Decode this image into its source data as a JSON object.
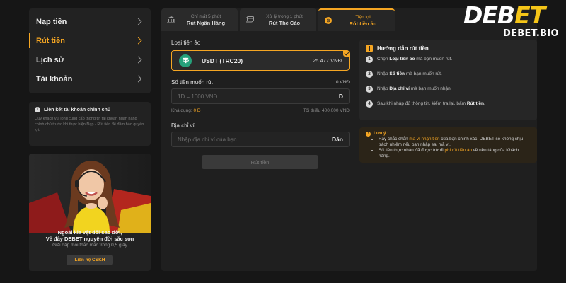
{
  "sidebar": {
    "items": [
      {
        "label": "Nạp tiền",
        "active": false
      },
      {
        "label": "Rút tiền",
        "active": true
      },
      {
        "label": "Lịch sử",
        "active": false
      },
      {
        "label": "Tài khoản",
        "active": false
      }
    ]
  },
  "link_card": {
    "title": "Liên kết tài khoản chính chủ",
    "description": "Quý khách vui lòng cung cấp thông tin tài khoản ngân hàng chính chủ trước khi thực hiện Nạp - Rút tiền để đảm bảo quyền lợi."
  },
  "promo": {
    "line1": "Ngoài kia vật đổi sao dời,",
    "line2": "Về đây DEBET nguyện đời sắc son",
    "subtitle": "Giải đáp mọi thắc mắc trong 0,5 giây",
    "button": "Liên hệ CSKH"
  },
  "tabs": [
    {
      "sub": "Chỉ mất 5 phút",
      "label": "Rút Ngân Hàng",
      "icon": "bank-icon",
      "active": false
    },
    {
      "sub": "Xử lý trong 1 phút",
      "label": "Rút Thẻ Cào",
      "icon": "card-icon",
      "active": false
    },
    {
      "sub": "Tiện lợi",
      "label": "Rút tiền ảo",
      "icon": "bitcoin-icon",
      "active": true
    }
  ],
  "form": {
    "coin_type_label": "Loại tiền ảo",
    "coin": {
      "name": "USDT (TRC20)",
      "balance": "25.477 VNĐ"
    },
    "amount_label": "Số tiền muốn rút",
    "amount_value": "0 VNĐ",
    "amount_placeholder": "1D = 1000 VNĐ",
    "amount_suffix": "D",
    "available_label": "Khả dụng:",
    "available_value": "0 D",
    "minimum": "Tối thiểu 400.000 VNĐ",
    "wallet_label": "Địa chỉ ví",
    "wallet_placeholder": "Nhập địa chỉ ví của bạn",
    "paste_label": "Dán",
    "submit_label": "Rút tiền"
  },
  "guide": {
    "title": "Hướng dẫn rút tiền",
    "steps": [
      {
        "num": "1",
        "pre": "Chọn ",
        "bold": "Loại tiền ảo",
        "post": " mà bạn muốn rút."
      },
      {
        "num": "2",
        "pre": "Nhập ",
        "bold": "Số tiền",
        "post": " mà bạn muốn rút."
      },
      {
        "num": "3",
        "pre": "Nhập ",
        "bold": "Địa chỉ ví",
        "post": " mà bạn muốn nhận."
      },
      {
        "num": "4",
        "pre": "Sau khi nhập đủ thông tin, kiểm tra lại, bấm ",
        "bold": "Rút tiền",
        "post": "."
      }
    ]
  },
  "note": {
    "title": "Lưu ý :",
    "item1_a": "Hãy chắc chắn ",
    "item1_hl": "mã ví nhận tiền",
    "item1_b": " của bạn chính xác. DEBET sẽ không chịu trách nhiệm nếu bạn nhập sai mã ví.",
    "item2_a": "Số tiền thực nhận đã được trừ đi ",
    "item2_hl": "phí rút tiền ảo",
    "item2_b": " về nền tảng của Khách hàng."
  },
  "logo": {
    "main_a": "DEB",
    "main_b": "ET",
    "sub": "DEBET.BIO"
  },
  "colors": {
    "accent": "#f5a623",
    "background": "#161616",
    "panel": "#1f1f1f",
    "tether": "#26a17b"
  }
}
